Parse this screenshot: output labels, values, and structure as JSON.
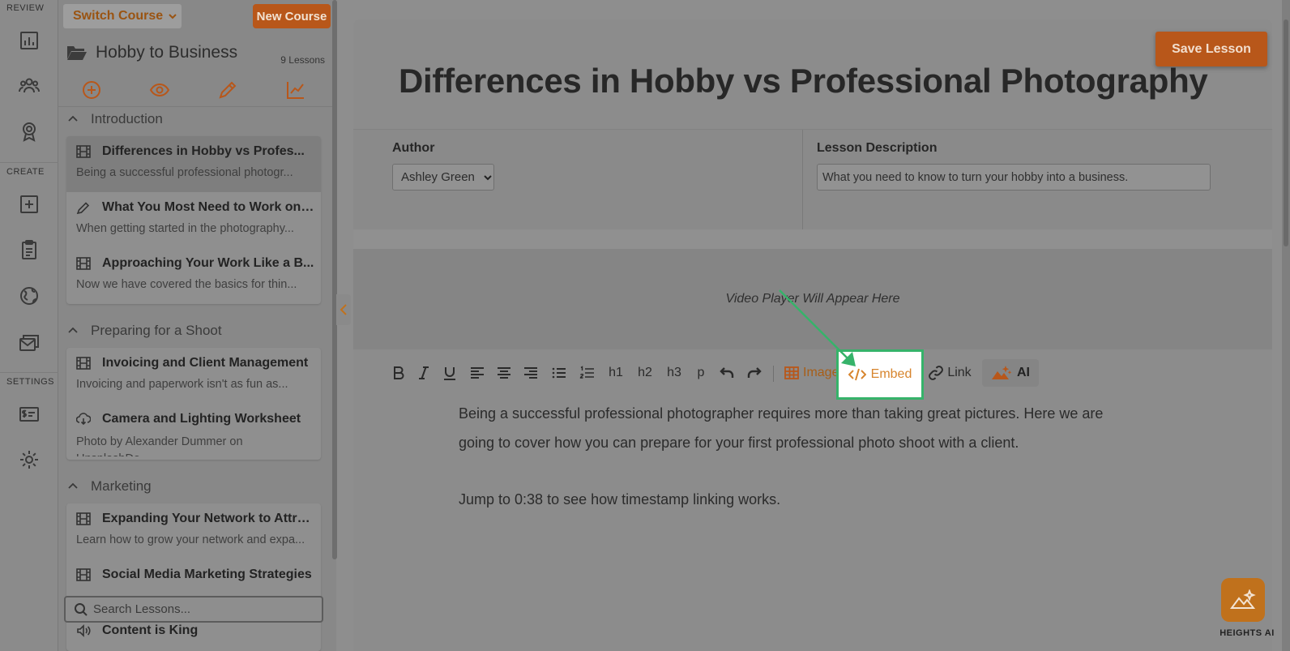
{
  "rail": {
    "review_label": "REVIEW",
    "create_label": "CREATE",
    "settings_label": "SETTINGS"
  },
  "sidebar": {
    "switch_course": "Switch Course",
    "new_course": "New Course",
    "course_title": "Hobby to Business",
    "lesson_count": "9 Lessons",
    "search_placeholder": "Search Lessons...",
    "sections": [
      {
        "title": "Introduction",
        "lessons": [
          {
            "title": "Differences in Hobby vs Profes...",
            "desc": "Being a successful professional photogr...",
            "icon": "film-icon",
            "active": true
          },
          {
            "title": "What You Most Need to Work on ...",
            "desc": "When getting started in the photography...",
            "icon": "pencil-icon"
          },
          {
            "title": "Approaching Your Work Like a B...",
            "desc": "Now we have covered the basics for thin...",
            "icon": "film-icon"
          }
        ]
      },
      {
        "title": "Preparing for a Shoot",
        "lessons": [
          {
            "title": "Invoicing and Client Management",
            "desc": "Invoicing and paperwork isn't as fun as...",
            "icon": "film-icon"
          },
          {
            "title": "Camera and Lighting Worksheet",
            "desc": "Photo by Alexander Dummer on UnsplashDo...",
            "icon": "download-icon"
          }
        ]
      },
      {
        "title": "Marketing",
        "lessons": [
          {
            "title": "Expanding Your Network to Attract",
            "desc": "Learn how to grow your network and expa...",
            "icon": "film-icon"
          },
          {
            "title": "Social Media Marketing Strategies",
            "desc": "",
            "icon": "film-icon"
          },
          {
            "title": "Content is King",
            "desc": "",
            "icon": "speaker-icon"
          }
        ]
      }
    ]
  },
  "editor": {
    "save_button": "Save Lesson",
    "lesson_title": "Differences in Hobby vs Professional Photography",
    "author_label": "Author",
    "author_value": "Ashley Green",
    "description_label": "Lesson Description",
    "description_value": "What you need to know to turn your hobby into a business.",
    "video_placeholder": "Video Player Will Appear Here",
    "toolbar": {
      "h1": "h1",
      "h2": "h2",
      "h3": "h3",
      "p": "p",
      "image": "Image",
      "embed": "Embed",
      "link": "Link",
      "ai": "AI"
    },
    "content": [
      "Being a successful professional photographer requires more than taking great pictures. Here we are going to cover how you can prepare for your first professional photo shoot with a client.",
      "Jump to 0:38 to see how timestamp linking works."
    ]
  },
  "heights_ai": {
    "label": "HEIGHTS AI"
  },
  "colors": {
    "accent": "#b8571a",
    "highlight_border": "#36b36a",
    "embed_text": "#d7852e"
  }
}
